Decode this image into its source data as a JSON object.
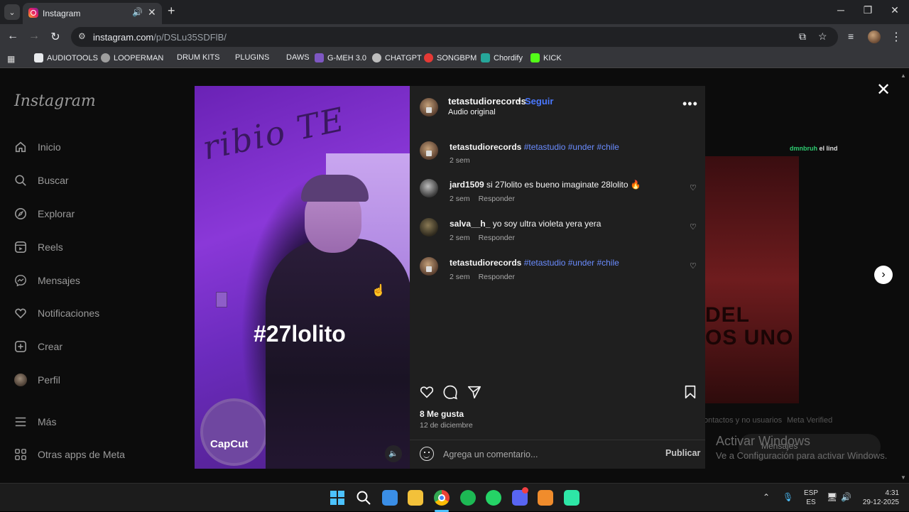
{
  "browser": {
    "tab_title": "Instagram",
    "url_host": "instagram.com",
    "url_path": "/p/DSLu35SDFlB/",
    "bookmarks": [
      {
        "label": "AUDIOTOOLS",
        "color": "#e8eaed"
      },
      {
        "label": "LOOPERMAN",
        "color": "#9e9e9e"
      },
      {
        "label": "DRUM KITS",
        "color": ""
      },
      {
        "label": "PLUGINS",
        "color": ""
      },
      {
        "label": "DAWS",
        "color": ""
      },
      {
        "label": "G-MEH 3.0",
        "color": "#7e57c2"
      },
      {
        "label": "CHATGPT",
        "color": "#bdbdbd"
      },
      {
        "label": "SONGBPM",
        "color": "#e53935"
      },
      {
        "label": "Chordify",
        "color": "#26a69a"
      },
      {
        "label": "KICK",
        "color": "#53fc18"
      }
    ]
  },
  "sidebar": {
    "logo": "Instagram",
    "items": [
      {
        "label": "Inicio",
        "icon": "home-icon"
      },
      {
        "label": "Buscar",
        "icon": "search-icon"
      },
      {
        "label": "Explorar",
        "icon": "compass-icon"
      },
      {
        "label": "Reels",
        "icon": "reels-icon"
      },
      {
        "label": "Mensajes",
        "icon": "messenger-icon"
      },
      {
        "label": "Notificaciones",
        "icon": "heart-icon"
      },
      {
        "label": "Crear",
        "icon": "plus-square-icon"
      },
      {
        "label": "Perfil",
        "icon": "avatar-icon"
      }
    ],
    "more_label": "Más",
    "meta_apps_label": "Otras apps de Meta"
  },
  "background": {
    "handle": "dmnbruh",
    "handle_text": "el lind",
    "poster_text": "DEL\nOS UNO",
    "footer_left": "ontactos y no usuarios",
    "footer_right": "Meta Verified",
    "activate_title": "Activar Windows",
    "activate_sub": "Ve a Configuración para activar Windows.",
    "messages_pill": "Mensajes"
  },
  "media": {
    "overlay_hashtag": "#27lolito",
    "watermark": "CapCut"
  },
  "post": {
    "username": "tetastudiorecords",
    "follow_label": "Seguir",
    "audio_label": "Audio original",
    "caption": {
      "user": "tetastudiorecords",
      "tags": "#tetastudio #under #chile",
      "time": "2 sem"
    },
    "comments": [
      {
        "user": "jard1509",
        "text": "si 27lolito es bueno imaginate 28lolito 🔥",
        "time": "2 sem",
        "reply": "Responder"
      },
      {
        "user": "salva__h_",
        "text": "yo soy ultra violeta yera yera",
        "time": "2 sem",
        "reply": "Responder"
      },
      {
        "user": "tetastudiorecords",
        "text": "#tetastudio #under #chile",
        "time": "2 sem",
        "reply": "Responder"
      }
    ],
    "likes": "8 Me gusta",
    "date": "12 de diciembre",
    "comment_placeholder": "Agrega un comentario...",
    "publish_label": "Publicar"
  },
  "taskbar": {
    "lang_top": "ESP",
    "lang_bottom": "ES",
    "time": "4:31",
    "date": "29-12-2025",
    "apps": [
      {
        "name": "windows-start-icon",
        "color": "#4cc2ff"
      },
      {
        "name": "search-icon",
        "color": "#ffffff"
      },
      {
        "name": "store-icon",
        "color": "#3a8ee6"
      },
      {
        "name": "file-explorer-icon",
        "color": "#f3c13a"
      },
      {
        "name": "chrome-icon",
        "color": "#4285f4"
      },
      {
        "name": "spotify-icon",
        "color": "#1db954"
      },
      {
        "name": "whatsapp-icon",
        "color": "#25d366"
      },
      {
        "name": "discord-icon",
        "color": "#5865f2"
      },
      {
        "name": "fl-studio-icon",
        "color": "#f08c2c"
      },
      {
        "name": "app-icon",
        "color": "#2ee6a6"
      }
    ]
  }
}
